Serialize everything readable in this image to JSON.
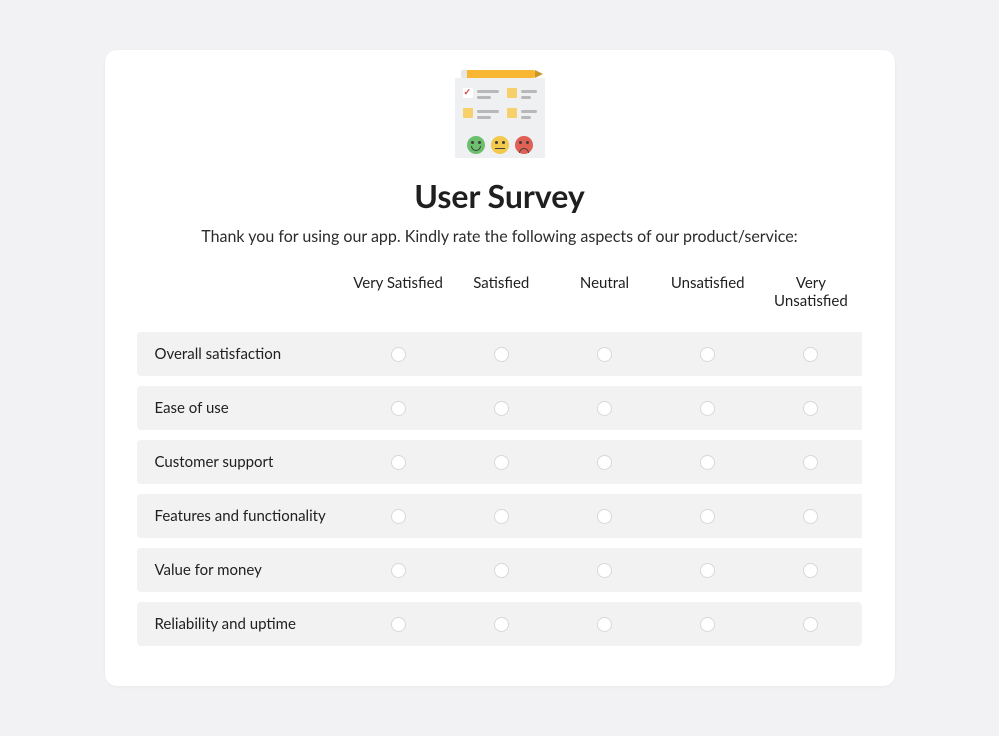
{
  "header": {
    "title": "User Survey",
    "subtitle": "Thank you for using our app. Kindly rate the following aspects of our product/service:"
  },
  "columns": [
    "Very Satisfied",
    "Satisfied",
    "Neutral",
    "Unsatisfied",
    "Very Unsatisfied"
  ],
  "rows": [
    {
      "label": "Overall satisfaction"
    },
    {
      "label": "Ease of use"
    },
    {
      "label": "Customer support"
    },
    {
      "label": "Features and functionality"
    },
    {
      "label": "Value for money"
    },
    {
      "label": "Reliability and uptime"
    }
  ]
}
